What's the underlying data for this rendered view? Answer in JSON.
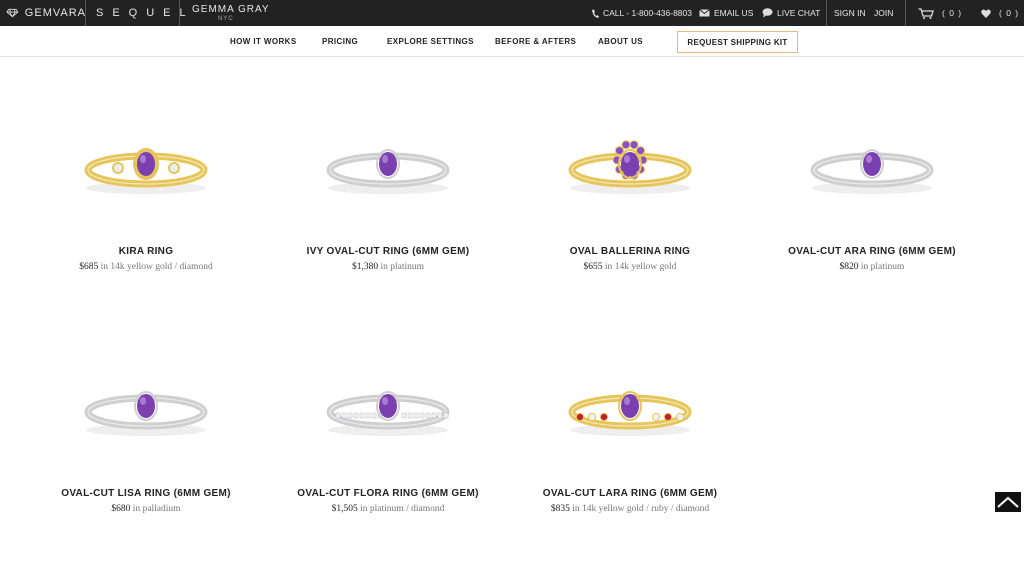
{
  "topbar": {
    "gemvara": "GEMVARA",
    "sequel": "SEQUEL",
    "gemma_gray": "GEMMA GRAY",
    "gemma_sub": "NYC",
    "call": "CALL - 1-800-436-8803",
    "email": "EMAIL US",
    "chat": "LIVE CHAT",
    "sign_in": "SIGN IN",
    "join": "JOIN",
    "cart_count": "( 0 )",
    "fav_count": "( 0 )"
  },
  "nav": {
    "how_it_works": "HOW IT WORKS",
    "pricing": "PRICING",
    "explore_settings": "EXPLORE SETTINGS",
    "before_afters": "BEFORE & AFTERS",
    "about_us": "ABOUT US",
    "request_kit": "REQUEST SHIPPING KIT"
  },
  "products": [
    {
      "name": "KIRA RING",
      "price": "$685",
      "in": "in",
      "material": "14k yellow gold / diamond",
      "metal": "#e6c55a",
      "stone": "#7b3fb0",
      "accent": "#e8eef6"
    },
    {
      "name": "IVY OVAL-CUT RING (6MM GEM)",
      "price": "$1,380",
      "in": "in",
      "material": "platinum",
      "metal": "#cfcfcf",
      "stone": "#7b3fb0",
      "accent": ""
    },
    {
      "name": "OVAL BALLERINA RING",
      "price": "$655",
      "in": "in",
      "material": "14k yellow gold",
      "metal": "#e6c55a",
      "stone": "#7b3fb0",
      "accent": "#8e4fc4"
    },
    {
      "name": "OVAL-CUT ARA RING (6MM GEM)",
      "price": "$820",
      "in": "in",
      "material": "platinum",
      "metal": "#cfcfcf",
      "stone": "#7b3fb0",
      "accent": ""
    },
    {
      "name": "OVAL-CUT LISA RING (6MM GEM)",
      "price": "$680",
      "in": "in",
      "material": "palladium",
      "metal": "#cfcfcf",
      "stone": "#7b3fb0",
      "accent": ""
    },
    {
      "name": "OVAL-CUT FLORA RING (6MM GEM)",
      "price": "$1,505",
      "in": "in",
      "material": "platinum / diamond",
      "metal": "#cfcfcf",
      "stone": "#7b3fb0",
      "accent": "#eef2f6"
    },
    {
      "name": "OVAL-CUT LARA RING (6MM GEM)",
      "price": "$835",
      "in": "in",
      "material": "14k yellow gold / ruby / diamond",
      "metal": "#e6c55a",
      "stone": "#7b3fb0",
      "accent": "#c0202a"
    }
  ]
}
